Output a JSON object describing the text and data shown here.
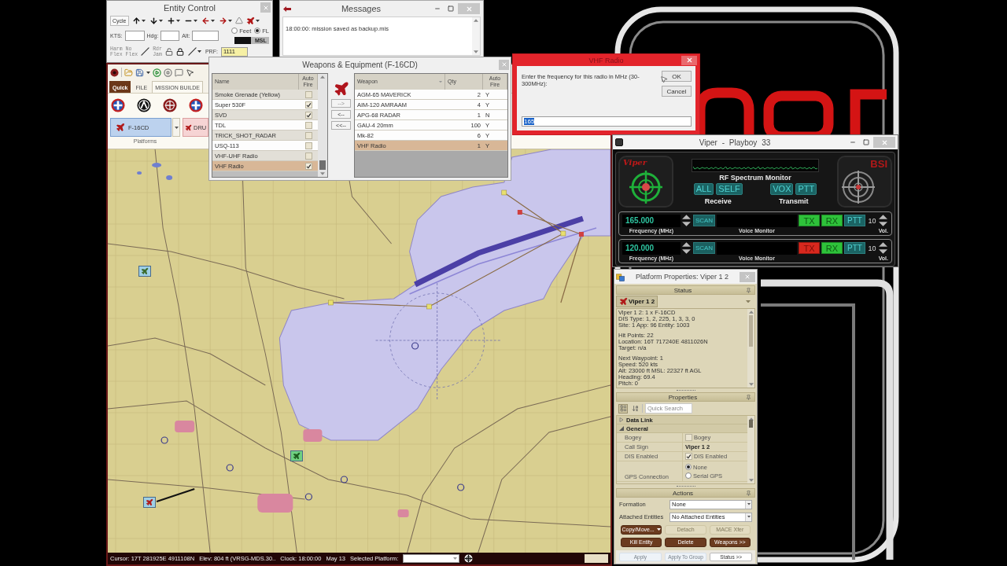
{
  "entity_control": {
    "title": "Entity Control",
    "cycle_label": "Cycle",
    "fields": [
      {
        "label": "KTS:"
      },
      {
        "label": "Hdg:"
      },
      {
        "label": "Alt:"
      }
    ],
    "altitude_units": [
      {
        "label": "Feet",
        "selected": false
      },
      {
        "label": "FL",
        "selected": true
      }
    ],
    "msl_toggle": "MSL",
    "jam_buttons": [
      {
        "label": "Harm Flex",
        "disabled": true
      },
      {
        "label": "No Flex",
        "disabled": true
      },
      {
        "label": "Rdr Jam",
        "disabled": true
      }
    ],
    "prf": {
      "label": "PRF:",
      "value": "1111"
    }
  },
  "messages": {
    "title": "Messages",
    "entries": [
      "18:00:00: mission saved as backup.mis"
    ]
  },
  "main_window": {
    "tabs": [
      {
        "label": "Quick",
        "kind": "menu",
        "selected": false
      },
      {
        "label": "FILE",
        "kind": "tab",
        "selected": false
      },
      {
        "label": "MISSION BUILDE",
        "kind": "tab",
        "selected": true
      }
    ],
    "platforms": [
      {
        "label": "F-16CD",
        "selected": true
      },
      {
        "label": "DRU",
        "selected": false
      }
    ],
    "platforms_group": "Platforms",
    "status_bar": {
      "cursor": "Cursor: 17T 281925E 4911108N",
      "elevation": "Elev: 804 ft (VRSG-MDS.30..",
      "clock": "Clock: 18:00:00",
      "date": "May 13",
      "selected_platform_label": "Selected Platform:"
    }
  },
  "weapons_dialog": {
    "title": "Weapons & Equipment (F-16CD)",
    "available": {
      "columns": [
        "Name",
        "Auto Fire"
      ],
      "rows": [
        {
          "name": "Smoke Grenade (Yellow)",
          "auto_fire": false,
          "selected": false
        },
        {
          "name": "Super 530F",
          "auto_fire": true,
          "selected": false
        },
        {
          "name": "SVD",
          "auto_fire": true,
          "selected": false
        },
        {
          "name": "TDL",
          "auto_fire": false,
          "selected": false
        },
        {
          "name": "TRICK_SHOT_RADAR",
          "auto_fire": false,
          "selected": false
        },
        {
          "name": "USQ-113",
          "auto_fire": false,
          "selected": false
        },
        {
          "name": "VHF-UHF Radio",
          "auto_fire": false,
          "selected": false
        },
        {
          "name": "VHF Radio",
          "auto_fire": true,
          "selected": true
        }
      ]
    },
    "transfer_buttons": [
      {
        "label": "-->",
        "disabled": true
      },
      {
        "label": "<--",
        "disabled": false
      },
      {
        "label": "<<--",
        "disabled": false
      }
    ],
    "loadout": {
      "columns": [
        "Weapon",
        "Qty",
        "Auto Fire"
      ],
      "rows": [
        {
          "weapon": "AGM-65 MAVERICK",
          "qty": "2",
          "auto_fire": "Y",
          "selected": false
        },
        {
          "weapon": "AIM-120 AMRAAM",
          "qty": "4",
          "auto_fire": "Y",
          "selected": false
        },
        {
          "weapon": "APG-68 RADAR",
          "qty": "1",
          "auto_fire": "N",
          "selected": false
        },
        {
          "weapon": "GAU-4 20mm",
          "qty": "100",
          "auto_fire": "Y",
          "selected": false
        },
        {
          "weapon": "Mk-82",
          "qty": "6",
          "auto_fire": "Y",
          "selected": false
        },
        {
          "weapon": "VHF Radio",
          "qty": "1",
          "auto_fire": "Y",
          "selected": true
        }
      ]
    }
  },
  "vhf_dialog": {
    "title": "VHF Radio",
    "prompt": "Enter the frequency for this radio in MHz (30-300MHz):",
    "buttons": [
      "OK",
      "Cancel"
    ],
    "value": "165"
  },
  "radio_window": {
    "title": "Viper - Playboy 33",
    "logo_text": "Viper",
    "monitor_title": "RF Spectrum Monitor",
    "receive": {
      "label": "Receive",
      "buttons": [
        "ALL",
        "SELF"
      ]
    },
    "transmit": {
      "label": "Transmit",
      "buttons": [
        "VOX",
        "PTT"
      ]
    },
    "brand_text": "BSI",
    "channels": [
      {
        "frequency": "165.000",
        "scan": "SCAN",
        "tx": "TX",
        "tx_enabled": true,
        "rx": "RX",
        "ptt": "PTT",
        "volume": "10",
        "frequency_label": "Frequency (MHz)",
        "monitor_label": "Voice Monitor",
        "volume_label": "Vol."
      },
      {
        "frequency": "120.000",
        "scan": "SCAN",
        "tx": "TX",
        "tx_enabled": false,
        "rx": "RX",
        "ptt": "PTT",
        "volume": "10",
        "frequency_label": "Frequency (MHz)",
        "monitor_label": "Voice Monitor",
        "volume_label": "Vol."
      }
    ]
  },
  "platform_properties": {
    "title": "Platform Properties: Viper 1 2",
    "status": {
      "header": "Status",
      "entity": "Viper 1 2",
      "paragraphs": [
        [
          "Viper 1 2: 1 x F-16CD",
          "DIS Type: 1, 2, 225, 1, 3, 3, 0",
          "Site: 1 App: 96 Entity: 1003"
        ],
        [
          "Hit Points: 22",
          "Location: 16T 717240E 4811026N",
          "Target: n/a"
        ],
        [
          "Next Waypoint: 1",
          "Speed: 520 kts",
          "Alt: 23000 ft MSL: 22327 ft AGL",
          "Heading: 69.4",
          "Pitch: 0"
        ]
      ]
    },
    "properties": {
      "header": "Properties",
      "view_buttons": [
        {
          "selected": true
        },
        {
          "selected": false
        }
      ],
      "search_placeholder": "Quick Search",
      "categories": [
        {
          "label": "Data Link",
          "expanded": false
        },
        {
          "label": "General",
          "expanded": true,
          "rows": [
            {
              "kind": "checkbox",
              "label": "Bogey",
              "text": "Bogey",
              "checked": false
            },
            {
              "kind": "text",
              "label": "Call Sign",
              "value": "Viper 1 2"
            },
            {
              "kind": "checkbox",
              "label": "DIS Enabled",
              "text": "DIS Enabled",
              "checked": true
            },
            {
              "kind": "radio",
              "label": "GPS Connection",
              "options": [
                {
                  "label": "None",
                  "selected": true
                },
                {
                  "label": "Serial GPS",
                  "selected": false
                }
              ]
            }
          ]
        }
      ]
    },
    "actions": {
      "header": "Actions",
      "fields": [
        {
          "label": "Formation",
          "value": "None"
        },
        {
          "label": "Attached Entities",
          "value": "No Attached Entities"
        }
      ],
      "buttons": [
        {
          "label": "Copy/Move...",
          "kind": "menu",
          "disabled": false
        },
        {
          "label": "Detach",
          "kind": "push",
          "disabled": true
        },
        {
          "label": "MACE Xfer",
          "kind": "push",
          "disabled": true
        },
        {
          "label": "Kill Entity",
          "kind": "push",
          "disabled": false
        },
        {
          "label": "Delete",
          "kind": "push",
          "disabled": false
        },
        {
          "label": "Weapons >>",
          "kind": "push",
          "disabled": false
        }
      ],
      "footer_buttons": [
        {
          "label": "Apply",
          "disabled": true
        },
        {
          "label": "Apply To Group",
          "disabled": true
        },
        {
          "label": "Status >>",
          "disabled": false
        }
      ]
    }
  }
}
